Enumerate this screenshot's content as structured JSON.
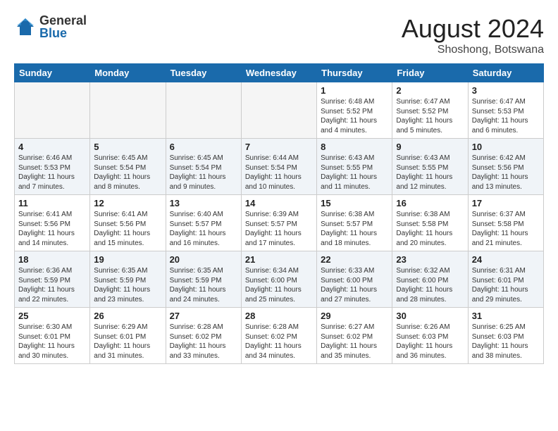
{
  "logo": {
    "general": "General",
    "blue": "Blue"
  },
  "title": {
    "month_year": "August 2024",
    "location": "Shoshong, Botswana"
  },
  "weekdays": [
    "Sunday",
    "Monday",
    "Tuesday",
    "Wednesday",
    "Thursday",
    "Friday",
    "Saturday"
  ],
  "weeks": [
    [
      {
        "day": "",
        "info": ""
      },
      {
        "day": "",
        "info": ""
      },
      {
        "day": "",
        "info": ""
      },
      {
        "day": "",
        "info": ""
      },
      {
        "day": "1",
        "info": "Sunrise: 6:48 AM\nSunset: 5:52 PM\nDaylight: 11 hours\nand 4 minutes."
      },
      {
        "day": "2",
        "info": "Sunrise: 6:47 AM\nSunset: 5:52 PM\nDaylight: 11 hours\nand 5 minutes."
      },
      {
        "day": "3",
        "info": "Sunrise: 6:47 AM\nSunset: 5:53 PM\nDaylight: 11 hours\nand 6 minutes."
      }
    ],
    [
      {
        "day": "4",
        "info": "Sunrise: 6:46 AM\nSunset: 5:53 PM\nDaylight: 11 hours\nand 7 minutes."
      },
      {
        "day": "5",
        "info": "Sunrise: 6:45 AM\nSunset: 5:54 PM\nDaylight: 11 hours\nand 8 minutes."
      },
      {
        "day": "6",
        "info": "Sunrise: 6:45 AM\nSunset: 5:54 PM\nDaylight: 11 hours\nand 9 minutes."
      },
      {
        "day": "7",
        "info": "Sunrise: 6:44 AM\nSunset: 5:54 PM\nDaylight: 11 hours\nand 10 minutes."
      },
      {
        "day": "8",
        "info": "Sunrise: 6:43 AM\nSunset: 5:55 PM\nDaylight: 11 hours\nand 11 minutes."
      },
      {
        "day": "9",
        "info": "Sunrise: 6:43 AM\nSunset: 5:55 PM\nDaylight: 11 hours\nand 12 minutes."
      },
      {
        "day": "10",
        "info": "Sunrise: 6:42 AM\nSunset: 5:56 PM\nDaylight: 11 hours\nand 13 minutes."
      }
    ],
    [
      {
        "day": "11",
        "info": "Sunrise: 6:41 AM\nSunset: 5:56 PM\nDaylight: 11 hours\nand 14 minutes."
      },
      {
        "day": "12",
        "info": "Sunrise: 6:41 AM\nSunset: 5:56 PM\nDaylight: 11 hours\nand 15 minutes."
      },
      {
        "day": "13",
        "info": "Sunrise: 6:40 AM\nSunset: 5:57 PM\nDaylight: 11 hours\nand 16 minutes."
      },
      {
        "day": "14",
        "info": "Sunrise: 6:39 AM\nSunset: 5:57 PM\nDaylight: 11 hours\nand 17 minutes."
      },
      {
        "day": "15",
        "info": "Sunrise: 6:38 AM\nSunset: 5:57 PM\nDaylight: 11 hours\nand 18 minutes."
      },
      {
        "day": "16",
        "info": "Sunrise: 6:38 AM\nSunset: 5:58 PM\nDaylight: 11 hours\nand 20 minutes."
      },
      {
        "day": "17",
        "info": "Sunrise: 6:37 AM\nSunset: 5:58 PM\nDaylight: 11 hours\nand 21 minutes."
      }
    ],
    [
      {
        "day": "18",
        "info": "Sunrise: 6:36 AM\nSunset: 5:59 PM\nDaylight: 11 hours\nand 22 minutes."
      },
      {
        "day": "19",
        "info": "Sunrise: 6:35 AM\nSunset: 5:59 PM\nDaylight: 11 hours\nand 23 minutes."
      },
      {
        "day": "20",
        "info": "Sunrise: 6:35 AM\nSunset: 5:59 PM\nDaylight: 11 hours\nand 24 minutes."
      },
      {
        "day": "21",
        "info": "Sunrise: 6:34 AM\nSunset: 6:00 PM\nDaylight: 11 hours\nand 25 minutes."
      },
      {
        "day": "22",
        "info": "Sunrise: 6:33 AM\nSunset: 6:00 PM\nDaylight: 11 hours\nand 27 minutes."
      },
      {
        "day": "23",
        "info": "Sunrise: 6:32 AM\nSunset: 6:00 PM\nDaylight: 11 hours\nand 28 minutes."
      },
      {
        "day": "24",
        "info": "Sunrise: 6:31 AM\nSunset: 6:01 PM\nDaylight: 11 hours\nand 29 minutes."
      }
    ],
    [
      {
        "day": "25",
        "info": "Sunrise: 6:30 AM\nSunset: 6:01 PM\nDaylight: 11 hours\nand 30 minutes."
      },
      {
        "day": "26",
        "info": "Sunrise: 6:29 AM\nSunset: 6:01 PM\nDaylight: 11 hours\nand 31 minutes."
      },
      {
        "day": "27",
        "info": "Sunrise: 6:28 AM\nSunset: 6:02 PM\nDaylight: 11 hours\nand 33 minutes."
      },
      {
        "day": "28",
        "info": "Sunrise: 6:28 AM\nSunset: 6:02 PM\nDaylight: 11 hours\nand 34 minutes."
      },
      {
        "day": "29",
        "info": "Sunrise: 6:27 AM\nSunset: 6:02 PM\nDaylight: 11 hours\nand 35 minutes."
      },
      {
        "day": "30",
        "info": "Sunrise: 6:26 AM\nSunset: 6:03 PM\nDaylight: 11 hours\nand 36 minutes."
      },
      {
        "day": "31",
        "info": "Sunrise: 6:25 AM\nSunset: 6:03 PM\nDaylight: 11 hours\nand 38 minutes."
      }
    ]
  ]
}
